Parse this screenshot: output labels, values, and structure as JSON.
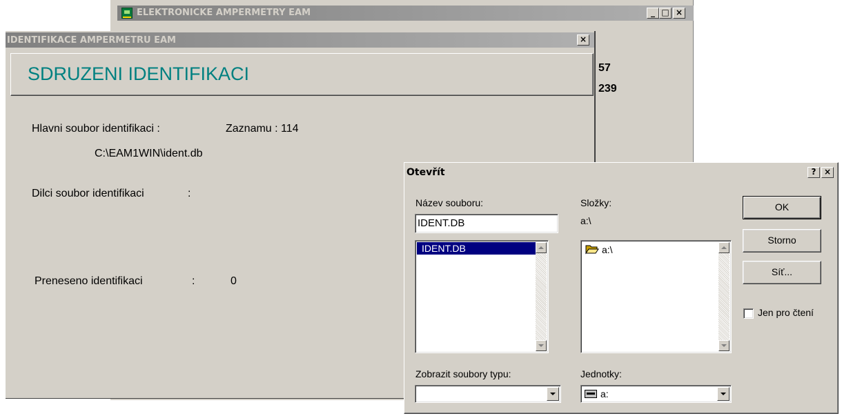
{
  "main_window": {
    "title": "ELEKTRONICKE AMPERMETRY EAM",
    "btn_min": "_",
    "btn_max": "□",
    "btn_close": "×",
    "side_values": [
      "57",
      "239"
    ]
  },
  "ident_dialog": {
    "title": "IDENTIFIKACE AMPERMETRU EAM",
    "close": "×",
    "banner": "SDRUZENI IDENTIFIKACI",
    "main_file_label": "Hlavni soubor identifikaci :",
    "records_label": "Zaznamu : 114",
    "main_file_path": "C:\\EAM1WIN\\ident.db",
    "partial_file_label": "Dilci soubor identifikaci",
    "partial_file_colon": ":",
    "transferred_label": "Preneseno identifikaci",
    "transferred_colon": ":",
    "transferred_value": "0"
  },
  "open_dialog": {
    "title": "Otevřít",
    "help_btn": "?",
    "close_btn": "×",
    "filename_label": "Název souboru:",
    "filename_value": "IDENT.DB",
    "file_list": [
      "IDENT.DB"
    ],
    "folders_label": "Složky:",
    "current_folder": "a:\\",
    "folder_list": [
      "a:\\"
    ],
    "filetype_label": "Zobrazit soubory typu:",
    "filetype_value": "",
    "drives_label": "Jednotky:",
    "drive_value": "a:",
    "ok_label": "OK",
    "cancel_label": "Storno",
    "network_label": "Síť...",
    "readonly_label": "Jen pro čtení",
    "readonly_checked": false
  },
  "colors": {
    "face": "#d4d0c8",
    "banner_text": "#008080",
    "selection": "#000080",
    "active_title_start": "#000080",
    "active_title_end": "#a6caf0"
  }
}
